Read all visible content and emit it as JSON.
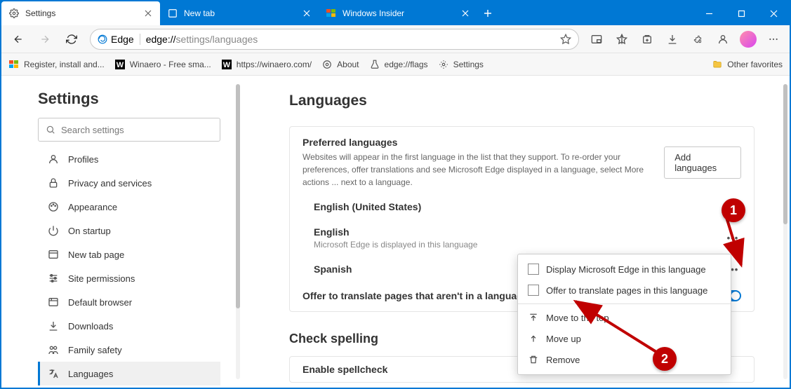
{
  "tabs": [
    {
      "label": "Settings"
    },
    {
      "label": "New tab"
    },
    {
      "label": "Windows Insider"
    }
  ],
  "url": {
    "prefix": "Edge",
    "protocol": "edge://",
    "dim": "settings/languages"
  },
  "bookmarks": [
    {
      "label": "Register, install and..."
    },
    {
      "label": "Winaero - Free sma..."
    },
    {
      "label": "https://winaero.com/"
    },
    {
      "label": "About"
    },
    {
      "label": "edge://flags"
    },
    {
      "label": "Settings"
    }
  ],
  "otherFav": "Other favorites",
  "sidebar": {
    "title": "Settings",
    "searchPlaceholder": "Search settings",
    "items": [
      {
        "label": "Profiles"
      },
      {
        "label": "Privacy and services"
      },
      {
        "label": "Appearance"
      },
      {
        "label": "On startup"
      },
      {
        "label": "New tab page"
      },
      {
        "label": "Site permissions"
      },
      {
        "label": "Default browser"
      },
      {
        "label": "Downloads"
      },
      {
        "label": "Family safety"
      },
      {
        "label": "Languages"
      }
    ]
  },
  "main": {
    "heading": "Languages",
    "preferred": {
      "title": "Preferred languages",
      "desc": "Websites will appear in the first language in the list that they support. To re-order your preferences, offer translations and see Microsoft Edge displayed in a language, select More actions ... next to a language.",
      "addBtn": "Add languages",
      "langs": [
        {
          "name": "English (United States)",
          "sub": ""
        },
        {
          "name": "English",
          "sub": "Microsoft Edge is displayed in this language"
        },
        {
          "name": "Spanish",
          "sub": ""
        }
      ],
      "offer": "Offer to translate pages that aren't in a language I rea"
    },
    "spell": {
      "heading": "Check spelling",
      "enable": "Enable spellcheck"
    }
  },
  "ctx": {
    "display": "Display Microsoft Edge in this language",
    "offer": "Offer to translate pages in this language",
    "top": "Move to the top",
    "up": "Move up",
    "remove": "Remove"
  },
  "annot": {
    "b1": "1",
    "b2": "2"
  }
}
